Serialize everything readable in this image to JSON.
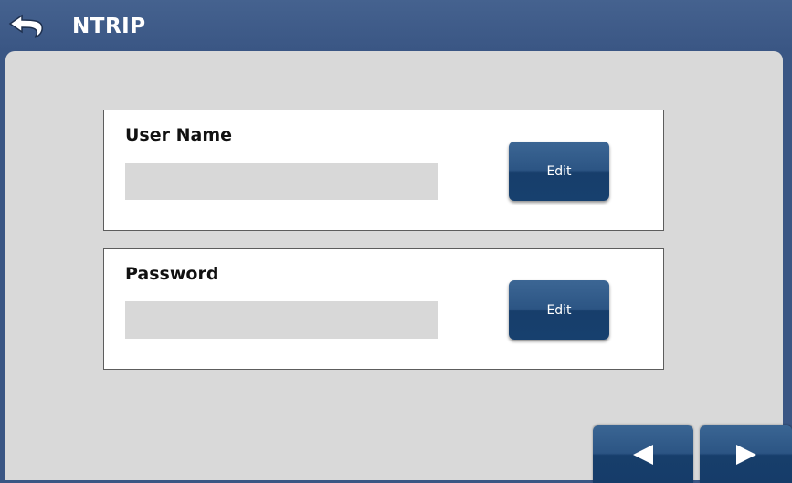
{
  "header": {
    "title": "NTRIP",
    "back_icon": "back-arrow-icon"
  },
  "user_name": {
    "label": "User Name",
    "value": "",
    "edit_label": "Edit"
  },
  "password": {
    "label": "Password",
    "value": "",
    "edit_label": "Edit"
  },
  "navigation": {
    "prev_icon": "triangle-left-icon",
    "next_icon": "triangle-right-icon"
  },
  "colors": {
    "header": "#3a5684",
    "content": "#d9d9d9",
    "button": "#1f4a7b"
  }
}
